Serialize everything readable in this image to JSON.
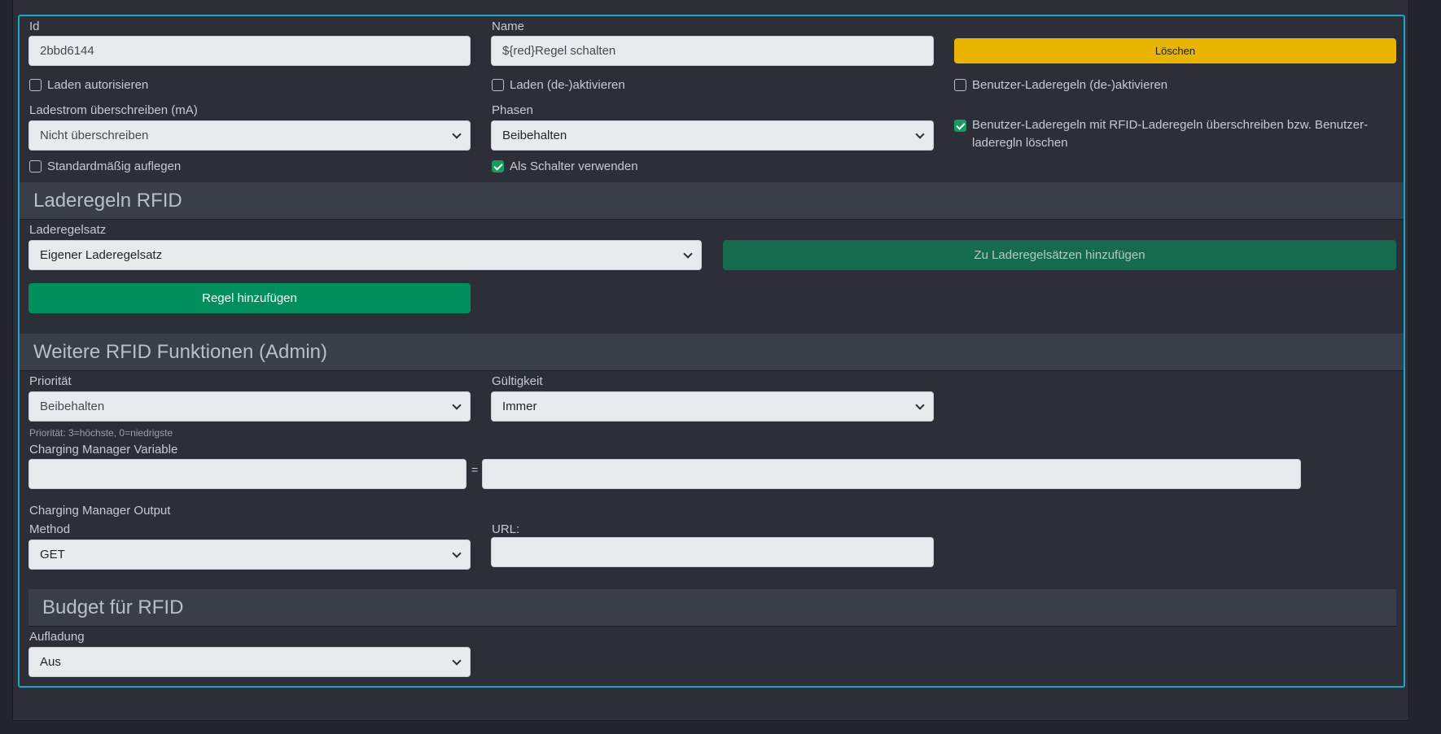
{
  "general": {
    "id_label": "Id",
    "id_value": "2bbd6144",
    "name_label": "Name",
    "name_value": "${red}Regel schalten",
    "delete_label": "Löschen",
    "cb_authorize": "Laden autorisieren",
    "cb_toggle_charging": "Laden (de-)aktivieren",
    "cb_user_rules": "Benutzer-Laderegeln (de-)aktivieren",
    "current_label": "Ladestrom überschreiben (mA)",
    "current_value": "Nicht überschreiben",
    "phases_label": "Phasen",
    "phases_value": "Beibehalten",
    "cb_override_rules": "Benutzer-Laderegeln mit RFID-Laderegeln überschreiben bzw. Benutzer-laderegln löschen",
    "cb_default_hangup": "Standardmäßig auflegen",
    "cb_use_as_switch": "Als Schalter verwenden"
  },
  "rules": {
    "title": "Laderegeln RFID",
    "ruleset_label": "Laderegelsatz",
    "ruleset_value": "Eigener Laderegelsatz",
    "add_to_rulesets": "Zu Laderegelsätzen hinzufügen",
    "add_rule": "Regel hinzufügen"
  },
  "admin": {
    "title": "Weitere RFID Funktionen (Admin)",
    "priority_label": "Priorität",
    "priority_value": "Beibehalten",
    "priority_hint": "Priorität: 3=höchste, 0=niedrigste",
    "validity_label": "Gültigkeit",
    "validity_value": "Immer",
    "cm_variable_label": "Charging Manager Variable",
    "equals": "=",
    "cm_output_label": "Charging Manager Output",
    "method_label": "Method",
    "method_value": "GET",
    "url_label": "URL:"
  },
  "budget": {
    "title": "Budget für RFID",
    "charging_label": "Aufladung",
    "charging_value": "Aus"
  },
  "checkbox_states": {
    "authorize": false,
    "toggle_charging": false,
    "user_rules": false,
    "override_rules": true,
    "default_hangup": false,
    "use_as_switch": true
  }
}
